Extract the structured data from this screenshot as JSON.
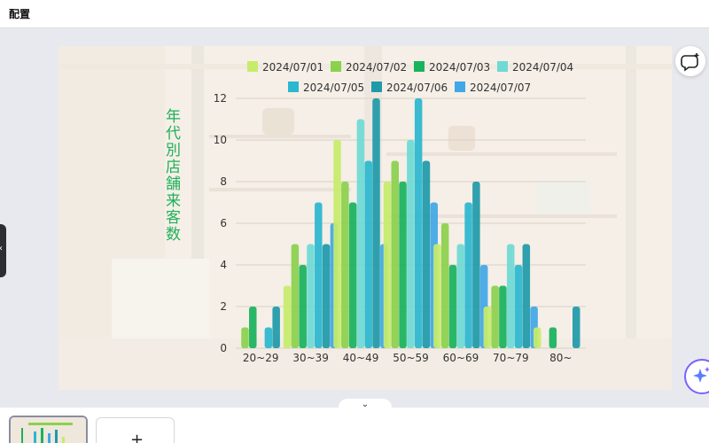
{
  "topbar": {
    "title": "配置"
  },
  "chart_data": {
    "type": "bar",
    "title": "年代別店舗来客数",
    "categories": [
      "20~29",
      "30~39",
      "40~49",
      "50~59",
      "60~69",
      "70~79",
      "80~"
    ],
    "ylim": [
      0,
      12
    ],
    "yticks": [
      "0",
      "2",
      "4",
      "6",
      "8",
      "10",
      "12"
    ],
    "legend_position": "top",
    "series": [
      {
        "name": "2024/07/01",
        "color": "#c6ec6b",
        "values": [
          0,
          3,
          10,
          8,
          5,
          2,
          1
        ]
      },
      {
        "name": "2024/07/02",
        "color": "#8bd14e",
        "values": [
          1,
          5,
          8,
          9,
          6,
          3,
          0
        ]
      },
      {
        "name": "2024/07/03",
        "color": "#19b35c",
        "values": [
          2,
          4,
          7,
          8,
          4,
          3,
          1
        ]
      },
      {
        "name": "2024/07/04",
        "color": "#6fd9d4",
        "values": [
          0,
          5,
          11,
          10,
          5,
          5,
          0
        ]
      },
      {
        "name": "2024/07/05",
        "color": "#2bb7cf",
        "values": [
          1,
          7,
          9,
          12,
          7,
          4,
          0
        ]
      },
      {
        "name": "2024/07/06",
        "color": "#1f9aa9",
        "values": [
          2,
          5,
          12,
          9,
          8,
          5,
          2
        ]
      },
      {
        "name": "2024/07/07",
        "color": "#41a7e6",
        "values": [
          0,
          6,
          5,
          7,
          4,
          2,
          0
        ]
      }
    ]
  },
  "icons": {
    "comment": "comment-add-icon",
    "magic": "sparkle-icon",
    "collapse": "chevron-down-icon",
    "handle": "chevron-left-icon",
    "add": "plus-icon"
  },
  "bottombar": {
    "add_label": "+",
    "collapse_label": "⌄",
    "handle_label": "‹"
  }
}
